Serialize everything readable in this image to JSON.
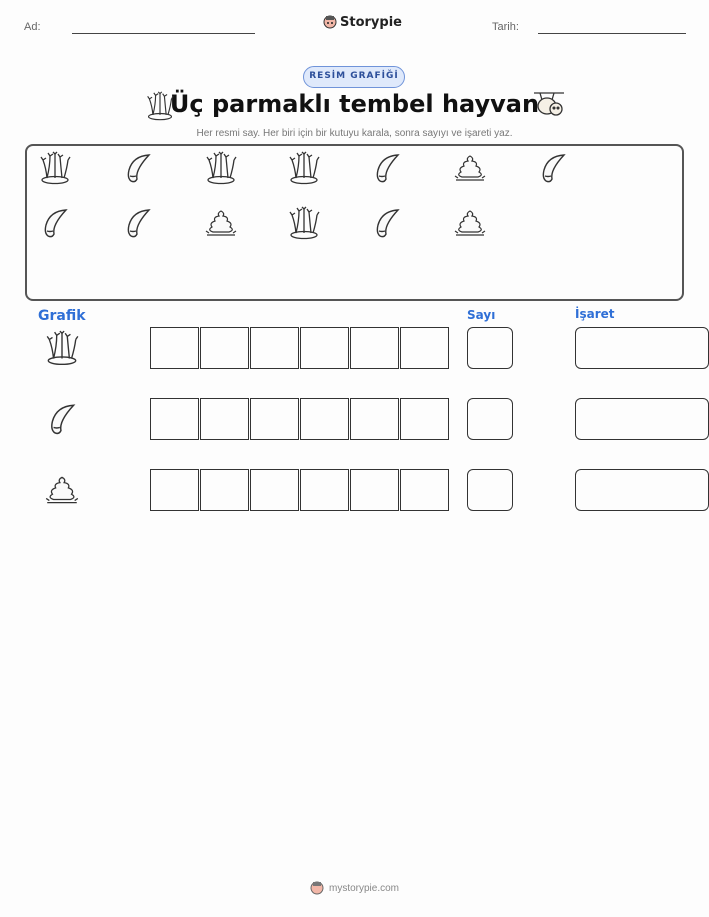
{
  "header": {
    "name_label": "Ad:",
    "date_label": "Tarih:",
    "brand": "Storypie"
  },
  "badge": "RESİM GRAFİĞİ",
  "title": "Üç parmaklı tembel hayvan",
  "subtitle": "Her resmi say. Her biri için bir kutuyu karala, sonra sayıyı ve işareti yaz.",
  "picture_items": [
    "coral-icon",
    "claw-icon",
    "coral-icon",
    "coral-icon",
    "claw-icon",
    "dung-icon",
    "claw-icon",
    "claw-icon",
    "claw-icon",
    "dung-icon",
    "coral-icon",
    "claw-icon",
    "dung-icon"
  ],
  "table": {
    "col_graph": "Grafik",
    "col_count": "Sayı",
    "col_tally": "İşaret",
    "rows": [
      {
        "icon": "coral-icon",
        "cells": 6
      },
      {
        "icon": "claw-icon",
        "cells": 6
      },
      {
        "icon": "dung-icon",
        "cells": 6
      }
    ]
  },
  "footer": "mystorypie.com"
}
